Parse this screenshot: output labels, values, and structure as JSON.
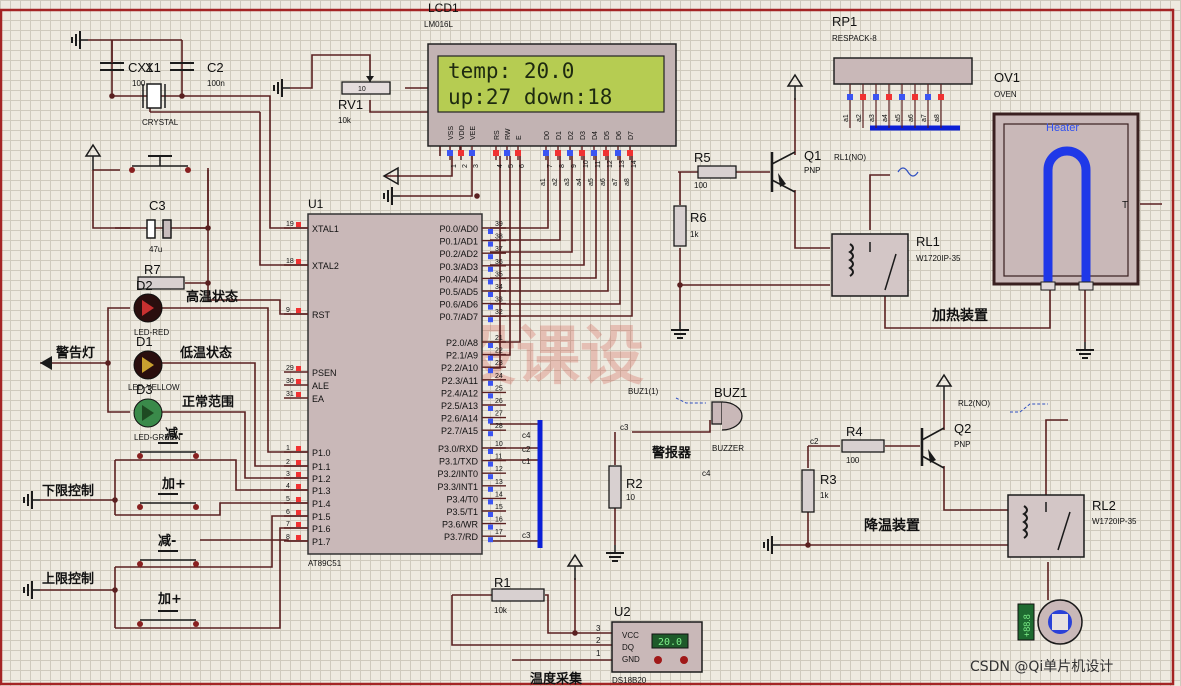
{
  "lcd": {
    "ref": "LCD1",
    "model": "LM016L",
    "line1": "temp: 20.0",
    "line2": "up:27  down:18",
    "pins": [
      "VSS",
      "VDD",
      "VEE",
      "RS",
      "RW",
      "E",
      "D0",
      "D1",
      "D2",
      "D3",
      "D4",
      "D5",
      "D6",
      "D7"
    ],
    "pin_numbers": [
      "1",
      "2",
      "3",
      "4",
      "5",
      "6",
      "7",
      "8",
      "9",
      "10",
      "11",
      "12",
      "13",
      "14"
    ]
  },
  "mcu": {
    "ref": "U1",
    "model": "AT89C51",
    "left_pins": [
      [
        "XTAL1",
        "19"
      ],
      [
        "XTAL2",
        "18"
      ],
      [
        "RST",
        "9"
      ],
      [
        "PSEN",
        "29"
      ],
      [
        "ALE",
        "30"
      ],
      [
        "EA",
        "31"
      ],
      [
        "P1.0",
        "1"
      ],
      [
        "P1.1",
        "2"
      ],
      [
        "P1.2",
        "3"
      ],
      [
        "P1.3",
        "4"
      ],
      [
        "P1.4",
        "5"
      ],
      [
        "P1.5",
        "6"
      ],
      [
        "P1.6",
        "7"
      ],
      [
        "P1.7",
        "8"
      ]
    ],
    "right_pins": [
      [
        "P0.0/AD0",
        "39"
      ],
      [
        "P0.1/AD1",
        "38"
      ],
      [
        "P0.2/AD2",
        "37"
      ],
      [
        "P0.3/AD3",
        "36"
      ],
      [
        "P0.4/AD4",
        "35"
      ],
      [
        "P0.5/AD5",
        "34"
      ],
      [
        "P0.6/AD6",
        "33"
      ],
      [
        "P0.7/AD7",
        "32"
      ],
      [
        "P2.0/A8",
        "21"
      ],
      [
        "P2.1/A9",
        "22"
      ],
      [
        "P2.2/A10",
        "23"
      ],
      [
        "P2.3/A11",
        "24"
      ],
      [
        "P2.4/A12",
        "25"
      ],
      [
        "P2.5/A13",
        "26"
      ],
      [
        "P2.6/A14",
        "27"
      ],
      [
        "P2.7/A15",
        "28"
      ],
      [
        "P3.0/RXD",
        "10"
      ],
      [
        "P3.1/TXD",
        "11"
      ],
      [
        "P3.2/INT0",
        "12"
      ],
      [
        "P3.3/INT1",
        "13"
      ],
      [
        "P3.4/T0",
        "14"
      ],
      [
        "P3.5/T1",
        "15"
      ],
      [
        "P3.6/WR",
        "16"
      ],
      [
        "P3.7/RD",
        "17"
      ]
    ]
  },
  "components": {
    "cx1": {
      "ref": "CX1",
      "value": "100"
    },
    "x1": {
      "ref": "X1",
      "value": "CRYSTAL"
    },
    "c2": {
      "ref": "C2",
      "value": "100n"
    },
    "rv1": {
      "ref": "RV1",
      "value": "10k",
      "knob": "10"
    },
    "c3": {
      "ref": "C3",
      "value": "47u"
    },
    "r7": {
      "ref": "R7"
    },
    "d2": {
      "ref": "D2",
      "value": "LED-RED"
    },
    "d1": {
      "ref": "D1",
      "value": "LED-YELLOW"
    },
    "d3": {
      "ref": "D3",
      "value": "LED-GREEN"
    },
    "rp1": {
      "ref": "RP1",
      "value": "RESPACK-8"
    },
    "ov1": {
      "ref": "OV1",
      "value": "OVEN",
      "heater": "Heater",
      "terminal": "T"
    },
    "r5": {
      "ref": "R5",
      "value": "100"
    },
    "q1": {
      "ref": "Q1",
      "value": "PNP"
    },
    "r6": {
      "ref": "R6",
      "value": "1k"
    },
    "rl1": {
      "ref": "RL1",
      "value": "W1720IP-35",
      "probe": "RL1(NO)"
    },
    "buz1": {
      "ref": "BUZ1",
      "value": "BUZZER",
      "probe": "BUZ1(1)"
    },
    "r2": {
      "ref": "R2",
      "value": "10"
    },
    "r4": {
      "ref": "R4",
      "value": "100"
    },
    "q2": {
      "ref": "Q2",
      "value": "PNP"
    },
    "r3": {
      "ref": "R3",
      "value": "1k"
    },
    "rl2": {
      "ref": "RL2",
      "value": "W1720IP-35",
      "probe": "RL2(NO)"
    },
    "r1": {
      "ref": "R1",
      "value": "10k"
    },
    "u2": {
      "ref": "U2",
      "value": "DS18B20",
      "pins": [
        "VCC",
        "DQ",
        "GND"
      ],
      "pin_numbers": [
        "3",
        "2",
        "1"
      ],
      "reading": "20.0"
    },
    "motor": {
      "reading": "+88.8"
    }
  },
  "net_labels": {
    "a": [
      "a1",
      "a2",
      "a3",
      "a4",
      "a5",
      "a6",
      "a7",
      "a8"
    ],
    "c1": "c1",
    "c2": "c2",
    "c3": "c3",
    "c4": "c4"
  },
  "text_labels": {
    "high_temp": "高温状态",
    "low_temp": "低温状态",
    "normal": "正常范围",
    "alarm_light": "警告灯",
    "minus": "减-",
    "plus": "加+",
    "lower_limit": "下限控制",
    "upper_limit": "上限控制",
    "heating": "加热装置",
    "cooling": "降温装置",
    "alarm": "警报器",
    "temp_acq": "温度采集"
  },
  "watermark": "毕设课设",
  "credit": "CSDN @Qi单片机设计",
  "colors": {
    "wire": "#5a2020",
    "body": "#c9b8b8",
    "lcd_screen": "#b6cc52",
    "pin_blue": "#3b54f2",
    "pin_red": "#f03232",
    "bus": "#0b1fd6",
    "heater": "#1f38e8"
  }
}
